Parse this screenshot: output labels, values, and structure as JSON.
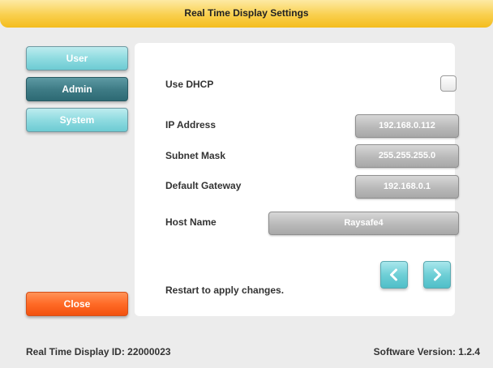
{
  "title": "Real Time Display Settings",
  "sidebar": {
    "items": [
      {
        "label": "User",
        "active": false
      },
      {
        "label": "Admin",
        "active": true
      },
      {
        "label": "System",
        "active": false
      }
    ],
    "close_label": "Close"
  },
  "network": {
    "use_dhcp_label": "Use DHCP",
    "use_dhcp_checked": false,
    "ip_label": "IP Address",
    "ip_value": "192.168.0.112",
    "subnet_label": "Subnet Mask",
    "subnet_value": "255.255.255.0",
    "gateway_label": "Default Gateway",
    "gateway_value": "192.168.0.1",
    "host_label": "Host Name",
    "host_value": "Raysafe4",
    "restart_note": "Restart to apply changes."
  },
  "nav": {
    "prev_icon": "chevron-left-icon",
    "next_icon": "chevron-right-icon"
  },
  "footer": {
    "device_id": "Real Time Display ID: 22000023",
    "software_version": "Software Version: 1.2.4"
  },
  "colors": {
    "title_bar": "#f9cf4d",
    "tab_light": "#8fdbe0",
    "tab_active": "#3f7c86",
    "close_button": "#ff6a26",
    "field_gray": "#b9b9b9"
  }
}
